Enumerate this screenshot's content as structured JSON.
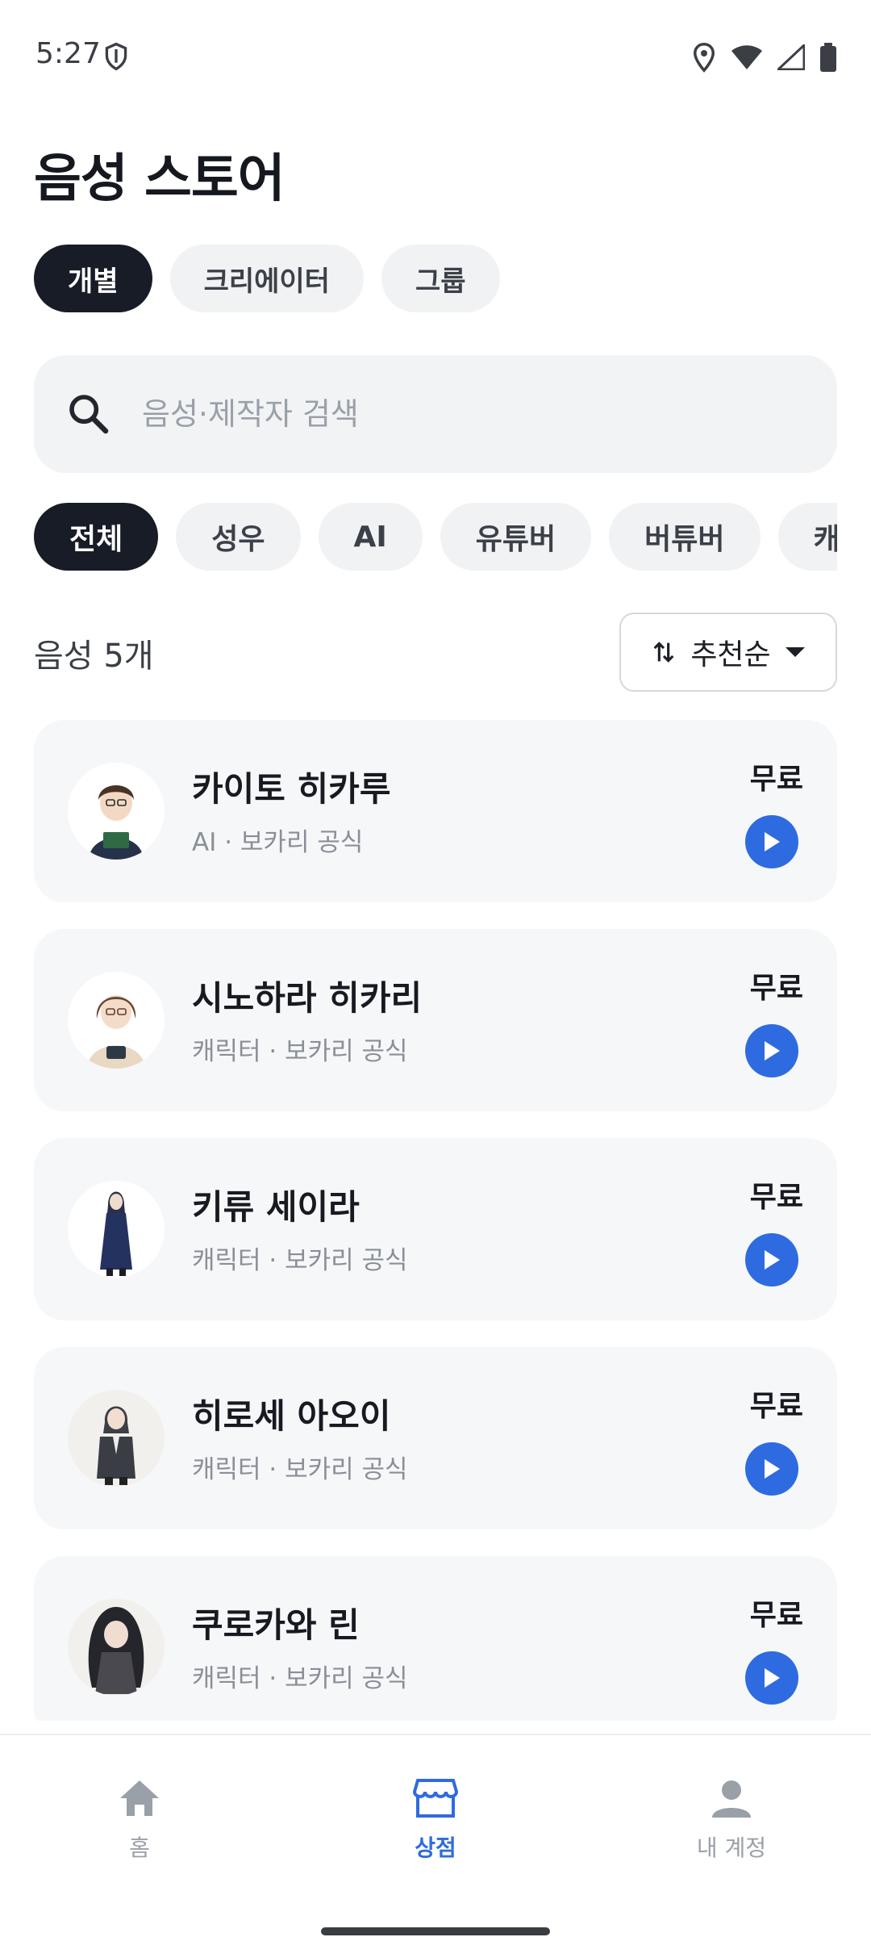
{
  "status_bar": {
    "time": "5:27"
  },
  "page_title": "음성 스토어",
  "segment_tabs": [
    {
      "label": "개별",
      "active": true
    },
    {
      "label": "크리에이터",
      "active": false
    },
    {
      "label": "그룹",
      "active": false
    }
  ],
  "search": {
    "placeholder": "음성·제작자 검색"
  },
  "filters": [
    {
      "label": "전체",
      "active": true
    },
    {
      "label": "성우",
      "active": false
    },
    {
      "label": "AI",
      "active": false
    },
    {
      "label": "유튜버",
      "active": false
    },
    {
      "label": "버튜버",
      "active": false
    },
    {
      "label": "캐릭터",
      "active": false
    }
  ],
  "list_header": {
    "count": "음성 5개",
    "sort_label": "추천순"
  },
  "voices": [
    {
      "name": "카이토 히카루",
      "meta": "AI · 보카리 공식",
      "price": "무료"
    },
    {
      "name": "시노하라 히카리",
      "meta": "캐릭터 · 보카리 공식",
      "price": "무료"
    },
    {
      "name": "키류 세이라",
      "meta": "캐릭터 · 보카리 공식",
      "price": "무료"
    },
    {
      "name": "히로세 아오이",
      "meta": "캐릭터 · 보카리 공식",
      "price": "무료"
    },
    {
      "name": "쿠로카와 린",
      "meta": "캐릭터 · 보카리 공식",
      "price": "무료"
    }
  ],
  "bottom_nav": [
    {
      "label": "홈",
      "icon": "home-icon",
      "active": false
    },
    {
      "label": "상점",
      "icon": "store-icon",
      "active": true
    },
    {
      "label": "내 계정",
      "icon": "person-icon",
      "active": false
    }
  ],
  "colors": {
    "accent": "#2f6be0",
    "dark_pill": "#171c26",
    "card_bg": "#f6f7f9"
  }
}
